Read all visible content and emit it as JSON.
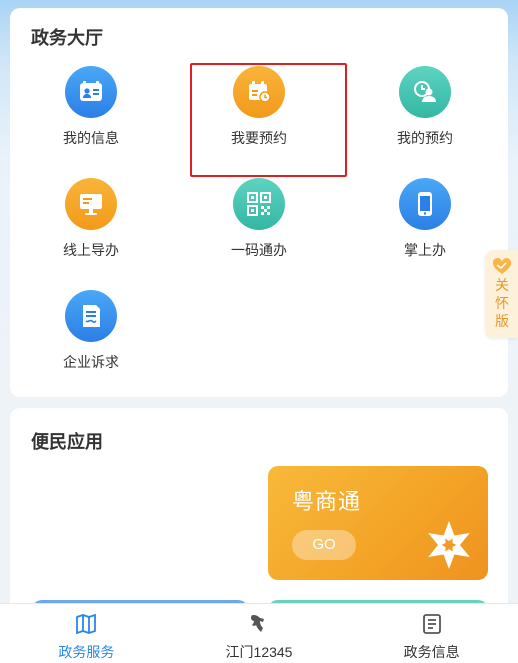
{
  "hall": {
    "title": "政务大厅",
    "items": [
      {
        "label": "我的信息",
        "icon": "id-card-icon",
        "color": "#2b7fe6"
      },
      {
        "label": "我要预约",
        "icon": "calendar-clock-icon",
        "color": "#f29a1a"
      },
      {
        "label": "我的预约",
        "icon": "user-clock-icon",
        "color": "#33b7a3"
      },
      {
        "label": "线上导办",
        "icon": "monitor-icon",
        "color": "#f29a1a"
      },
      {
        "label": "一码通办",
        "icon": "qr-code-icon",
        "color": "#33b7a3"
      },
      {
        "label": "掌上办",
        "icon": "phone-icon",
        "color": "#2b7fe6"
      },
      {
        "label": "企业诉求",
        "icon": "document-icon",
        "color": "#2b7fe6"
      }
    ]
  },
  "care_tab": {
    "label": "关怀版",
    "chars": [
      "关",
      "怀",
      "版"
    ]
  },
  "apps": {
    "title": "便民应用",
    "yueshangtong": {
      "name": "粤商通",
      "go_label": "GO"
    }
  },
  "bottom_nav": [
    {
      "label": "政务服务",
      "icon": "map-book-icon",
      "active": true
    },
    {
      "label": "江门12345",
      "icon": "horse-icon",
      "active": false
    },
    {
      "label": "政务信息",
      "icon": "notes-icon",
      "active": false
    }
  ],
  "colors": {
    "accent": "#2b86ea",
    "highlight_border": "#e02020",
    "orange": "#f29a1a",
    "teal": "#33b7a3"
  }
}
